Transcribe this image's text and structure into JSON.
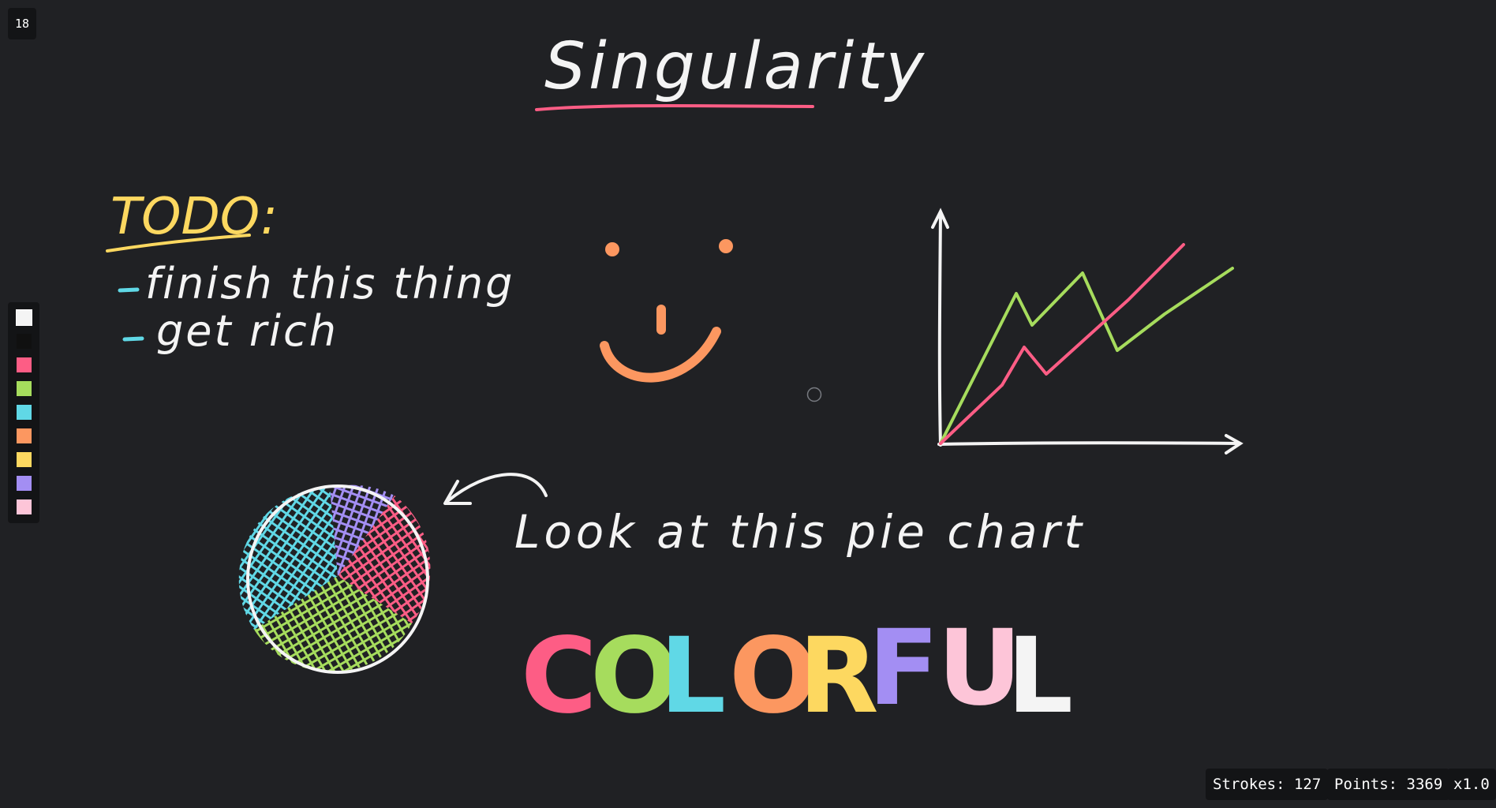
{
  "toolbar": {
    "brush_size": "18"
  },
  "palette": {
    "colors": [
      "#f4f4f4",
      "#101010",
      "#fd5d85",
      "#a6dc5d",
      "#60d8e6",
      "#fc9760",
      "#fdd860",
      "#a38ef3",
      "#fdc5d8"
    ],
    "selected_index": 0
  },
  "canvas": {
    "title": "Singularity",
    "todo_heading": "TODO:",
    "todo_items": [
      "finish this thing",
      "get rich"
    ],
    "pie_caption": "Look at this pie chart",
    "colorful_letters": [
      "C",
      "O",
      "L",
      "O",
      "R",
      "F",
      "U",
      "L"
    ],
    "colorful_colors": [
      "#fd5d85",
      "#a6dc5d",
      "#60d8e6",
      "#fc9760",
      "#fdd860",
      "#a38ef3",
      "#fdc5d8",
      "#f4f4f4"
    ]
  },
  "status": {
    "strokes_label": "Strokes:",
    "strokes_value": "127",
    "points_label": "Points:",
    "points_value": "3369",
    "zoom": "x1.0"
  }
}
